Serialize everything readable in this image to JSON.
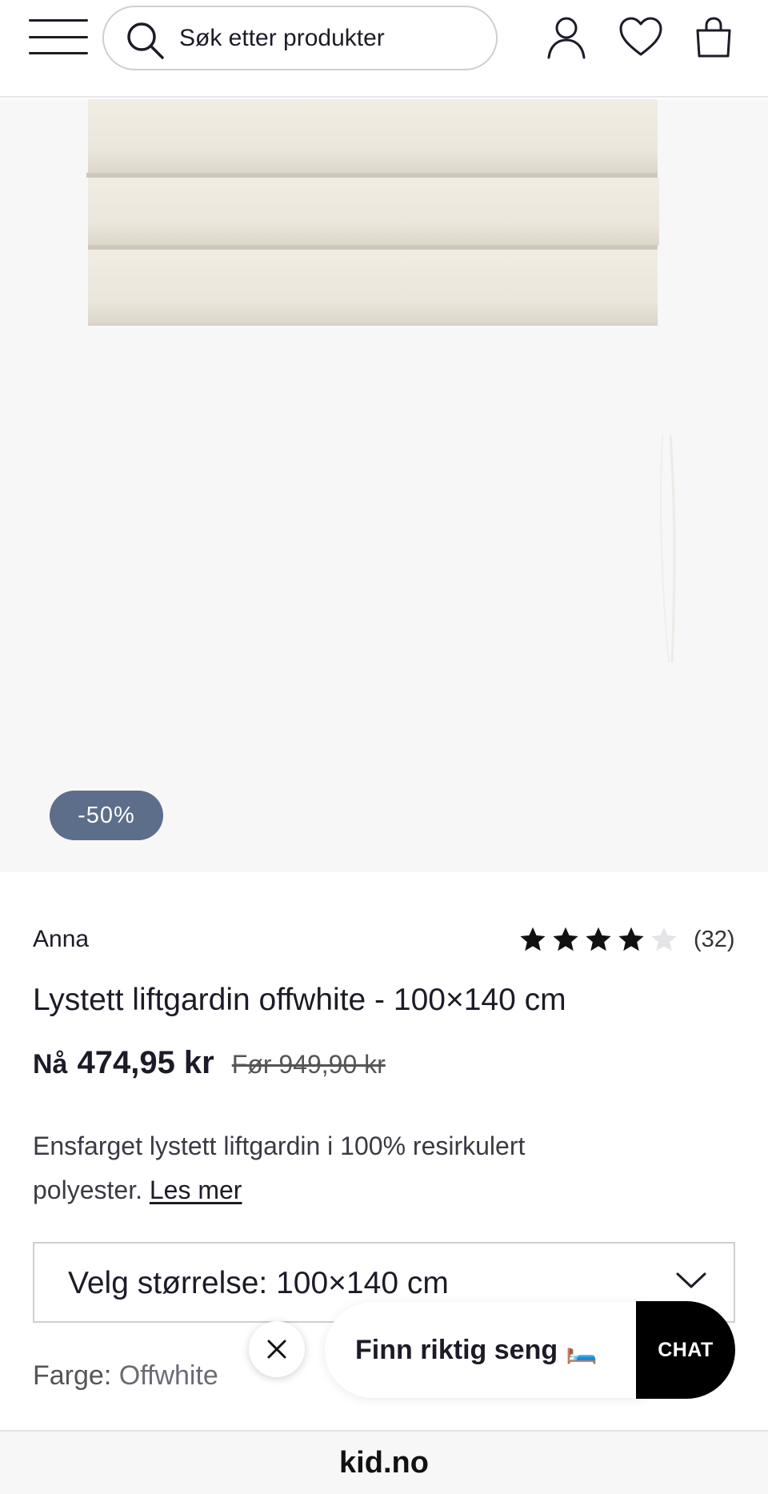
{
  "header": {
    "search_placeholder": "Søk etter produkter",
    "icons": [
      "menu-icon",
      "search-icon",
      "user-icon",
      "heart-icon",
      "bag-icon"
    ]
  },
  "product": {
    "discount_badge": "-50%",
    "brand": "Anna",
    "rating": {
      "stars_filled": 4,
      "stars_total": 5,
      "count": "(32)"
    },
    "title": "Lystett liftgardin offwhite - 100×140 cm",
    "price_now_label": "Nå",
    "price_now": "474,95 kr",
    "price_before": "Før 949,90 kr",
    "description": "Ensfarget lystett liftgardin i 100% resirkulert polyester.",
    "read_more": "Les mer",
    "size_select": "Velg størrelse: 100×140 cm",
    "color_label": "Farge:",
    "color_value": "Offwhite"
  },
  "chat_widget": {
    "prompt": "Finn riktig seng",
    "prompt_emoji": "🛏️",
    "button": "CHAT"
  },
  "browser": {
    "url": "kid.no"
  },
  "colors": {
    "badge": "#5c6e8a",
    "text": "#1c1c28",
    "image_bg": "#f7f7f8",
    "curtain": "#ede8dd"
  }
}
